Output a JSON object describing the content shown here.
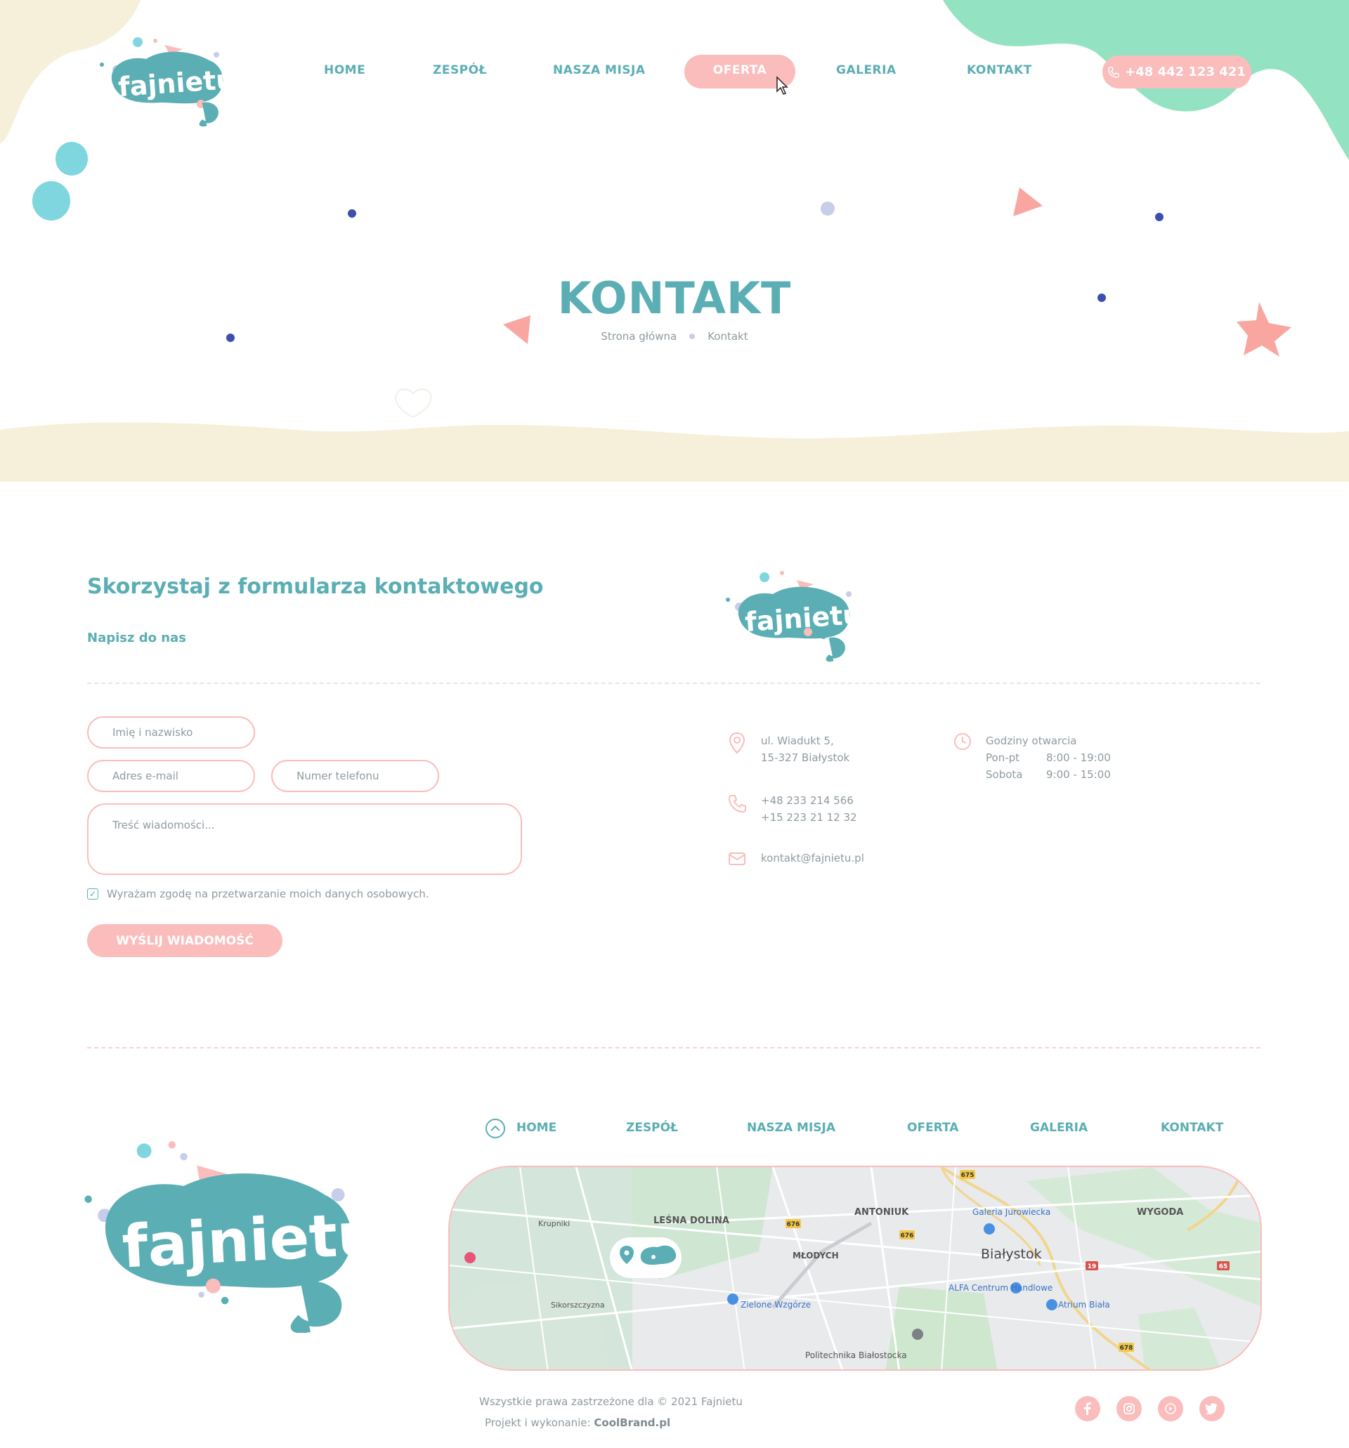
{
  "brand": {
    "logo_text": "fajnietu"
  },
  "nav": {
    "items": [
      "HOME",
      "ZESPÓŁ",
      "NASZA MISJA",
      "OFERTA",
      "GALERIA",
      "KONTAKT"
    ],
    "active": "OFERTA",
    "phone": "+48 442 123 421"
  },
  "hero": {
    "title": "KONTAKT",
    "breadcrumb": [
      "Strona główna",
      "Kontakt"
    ]
  },
  "contact_form": {
    "title": "Skorzystaj z formularza kontaktowego",
    "subtitle": "Napisz do nas",
    "name_placeholder": "Imię i nazwisko",
    "email_placeholder": "Adres e-mail",
    "phone_placeholder": "Numer telefonu",
    "message_placeholder": "Treść wiadomości...",
    "consent": "Wyrażam zgodę na przetwarzanie moich danych osobowych.",
    "consent_checked": true,
    "submit": "WYŚLIJ WIADOMOŚĆ"
  },
  "contact_info": {
    "address_line1": "ul. Wiadukt 5,",
    "address_line2": "15-327 Białystok",
    "phone1": "+48 233 214 566",
    "phone2": "+15 223 21 12 32",
    "email": "kontakt@fajnietu.pl",
    "hours_title": "Godziny otwarcia",
    "hours": [
      {
        "day": "Pon-pt",
        "time": "8:00 - 19:00"
      },
      {
        "day": "Sobota",
        "time": "9:00 - 15:00"
      }
    ]
  },
  "footer": {
    "nav": [
      "HOME",
      "ZESPÓŁ",
      "NASZA MISJA",
      "OFERTA",
      "GALERIA",
      "KONTAKT"
    ],
    "map_labels": [
      "LEŚNA DOLINA",
      "ANTONIUK",
      "Galeria Jurowiecka",
      "WYGODA",
      "Krupniki",
      "MŁODYCH",
      "Białystok",
      "ALFA Centrum Handlowe",
      "Atrium Biała",
      "Sikorszczyzna",
      "Zielone Wzgórze",
      "Politechnika Białostocka",
      "675",
      "676",
      "676",
      "19",
      "65",
      "678"
    ],
    "copyright_prefix": "Wszystkie prawa zastrzeżone dla © 2021 Fajnietu",
    "credit_prefix": "Projekt i wykonanie:",
    "credit_name": "CoolBrand.pl",
    "social": [
      "facebook-icon",
      "instagram-icon",
      "youtube-icon",
      "twitter-icon"
    ]
  },
  "colors": {
    "teal": "#5aaeb4",
    "pink": "#fbbcbc",
    "mint": "#93e3c2",
    "cream": "#f6f0da",
    "navy_dot": "#3b4fb0"
  }
}
